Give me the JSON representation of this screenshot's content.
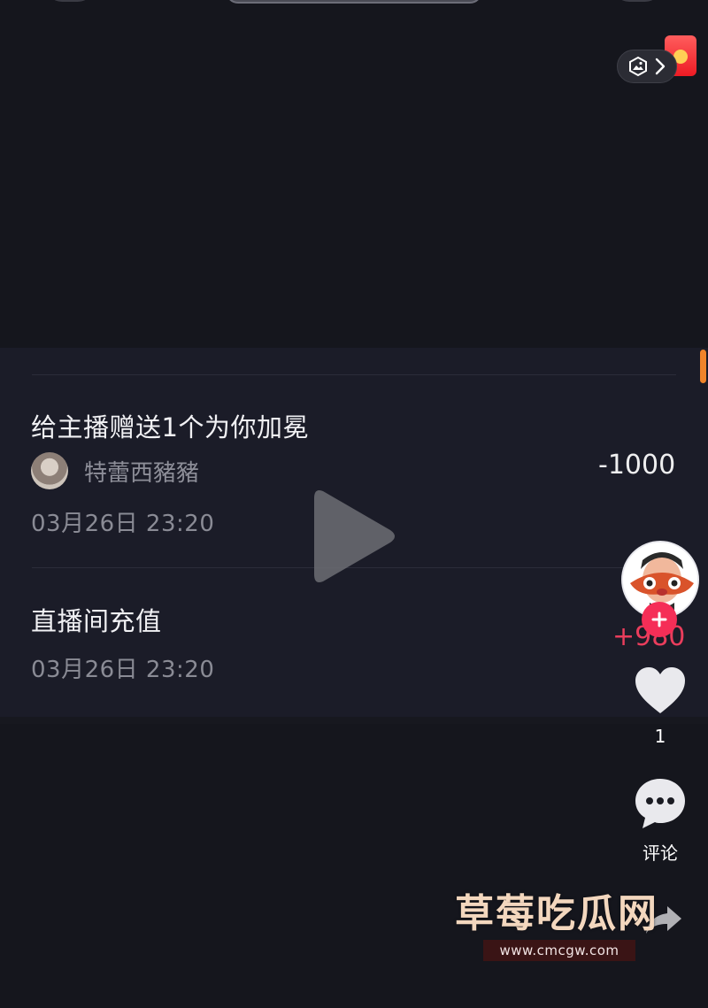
{
  "transactions": [
    {
      "title": "给主播赠送1个为你加冕",
      "user_name": "特蕾西豬豬",
      "amount": "-1000",
      "time": "03月26日 23:20"
    },
    {
      "title": "直播间充值",
      "amount": "+980",
      "time": "03月26日 23:20"
    }
  ],
  "rail": {
    "like_count": "1",
    "comment_label": "评论"
  },
  "watermark": {
    "title": "草莓吃瓜网",
    "url": "www.cmcgw.com"
  },
  "icons": {
    "image": "image-icon",
    "chevron": "chevron-right-icon",
    "play": "play-icon",
    "follow": "plus-icon",
    "like": "heart-icon",
    "comment": "comment-icon",
    "share": "share-icon",
    "red_packet": "red-packet-icon"
  },
  "colors": {
    "background": "#15161d",
    "card": "#1b1c28",
    "accent_red": "#f52e57",
    "scroll_accent": "#f0842a"
  }
}
